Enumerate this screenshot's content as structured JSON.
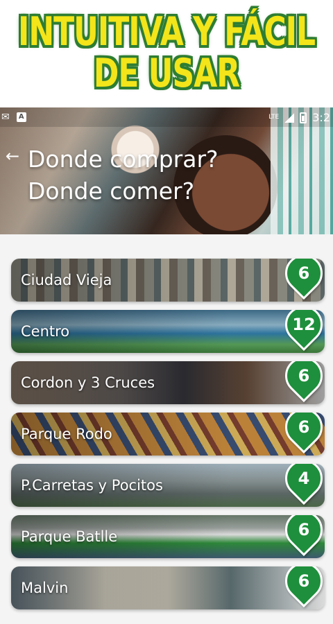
{
  "promo": {
    "line1": "INTUITIVA Y FÁCIL",
    "line2": "DE USAR"
  },
  "status_bar": {
    "left_letter": "A",
    "network": "LTE",
    "time": "3:2"
  },
  "header": {
    "back_icon": "arrow-left-icon",
    "title_line1": "Donde comprar?",
    "title_line2": "Donde comer?"
  },
  "neighborhoods": [
    {
      "name": "Ciudad Vieja",
      "count": "6"
    },
    {
      "name": "Centro",
      "count": "12"
    },
    {
      "name": "Cordon y 3 Cruces",
      "count": "6"
    },
    {
      "name": "Parque Rodo",
      "count": "6"
    },
    {
      "name": "P.Carretas y Pocitos",
      "count": "4"
    },
    {
      "name": "Parque Batlle",
      "count": "6"
    },
    {
      "name": "Malvin",
      "count": "6"
    }
  ],
  "colors": {
    "promo_text": "#f3e51a",
    "promo_outline": "#2e7d32",
    "pin_green": "#1e8f3c"
  }
}
